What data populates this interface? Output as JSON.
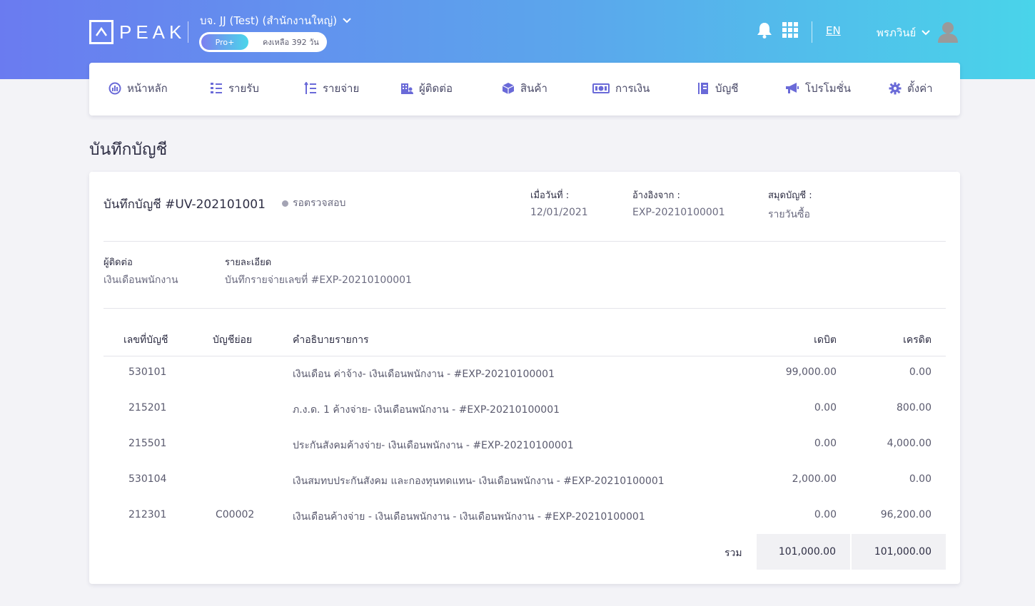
{
  "header": {
    "logo_text": "PEAK",
    "company": "บจ. JJ (Test) (สำนักงานใหญ่)",
    "plan_badge": "Pro+",
    "plan_remaining": "คงเหลือ 392 วัน",
    "language": "EN",
    "user_name": "พรภวินย์"
  },
  "nav": {
    "items": [
      {
        "label": "หน้าหลัก",
        "icon": "dashboard-icon"
      },
      {
        "label": "รายรับ",
        "icon": "income-list-icon"
      },
      {
        "label": "รายจ่าย",
        "icon": "expense-list-icon"
      },
      {
        "label": "ผู้ติดต่อ",
        "icon": "contacts-icon"
      },
      {
        "label": "สินค้า",
        "icon": "product-box-icon"
      },
      {
        "label": "การเงิน",
        "icon": "money-icon"
      },
      {
        "label": "บัญชี",
        "icon": "ledger-book-icon"
      },
      {
        "label": "โปรโมชั่น",
        "icon": "megaphone-icon"
      },
      {
        "label": "ตั้งค่า",
        "icon": "gear-icon"
      }
    ]
  },
  "page": {
    "title": "บันทึกบัญชี"
  },
  "voucher": {
    "title": "บันทึกบัญชี #UV-202101001",
    "status": "รอตรวจสอบ",
    "date_label": "เมื่อวันที่ :",
    "date_value": "12/01/2021",
    "reference_label": "อ้างอิงจาก :",
    "reference_value": "EXP-20210100001",
    "journal_label": "สมุดบัญชี :",
    "journal_value": "รายวันซื้อ",
    "contact_label": "ผู้ติดต่อ",
    "contact_value": "เงินเดือนพนักงาน",
    "detail_label": "รายละเอียด",
    "detail_value": "บันทึกรายจ่ายเลขที่ #EXP-20210100001"
  },
  "table": {
    "headers": {
      "account_no": "เลขที่บัญชี",
      "sub_account": "บัญชีย่อย",
      "description": "คำอธิบายรายการ",
      "debit": "เดบิต",
      "credit": "เครดิต"
    },
    "rows": [
      {
        "account_no": "530101",
        "sub_account": "",
        "description": "เงินเดือน ค่าจ้าง- เงินเดือนพนักงาน - #EXP-20210100001",
        "debit": "99,000.00",
        "credit": "0.00"
      },
      {
        "account_no": "215201",
        "sub_account": "",
        "description": "ภ.ง.ด. 1 ค้างจ่าย- เงินเดือนพนักงาน - #EXP-20210100001",
        "debit": "0.00",
        "credit": "800.00"
      },
      {
        "account_no": "215501",
        "sub_account": "",
        "description": "ประกันสังคมค้างจ่าย- เงินเดือนพนักงาน - #EXP-20210100001",
        "debit": "0.00",
        "credit": "4,000.00"
      },
      {
        "account_no": "530104",
        "sub_account": "",
        "description": "เงินสมทบประกันสังคม และกองทุนทดแทน- เงินเดือนพนักงาน - #EXP-20210100001",
        "debit": "2,000.00",
        "credit": "0.00"
      },
      {
        "account_no": "212301",
        "sub_account": "C00002",
        "description": "เงินเดือนค้างจ่าย - เงินเดือนพนักงาน - เงินเดือนพนักงาน - #EXP-20210100001",
        "debit": "0.00",
        "credit": "96,200.00"
      }
    ],
    "total_label": "รวม",
    "total_debit": "101,000.00",
    "total_credit": "101,000.00"
  }
}
